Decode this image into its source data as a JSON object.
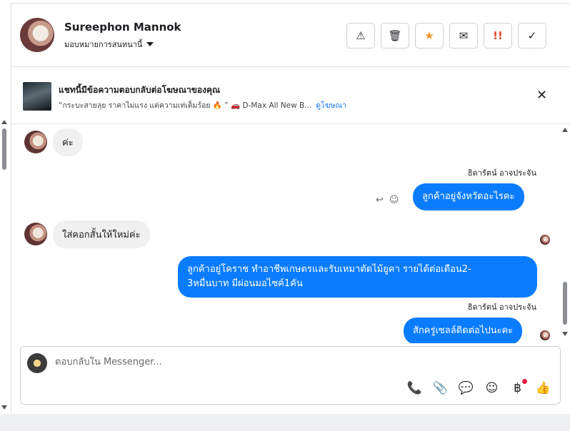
{
  "header": {
    "contact_name": "Sureephon Mannok",
    "assign_label": "มอบหมายการสนทนานี้",
    "actions": [
      {
        "name": "report-button",
        "icon": "⚠"
      },
      {
        "name": "delete-button",
        "icon": "🗑"
      },
      {
        "name": "star-button",
        "icon": "★"
      },
      {
        "name": "mark-unread-button",
        "icon": "✉"
      },
      {
        "name": "mark-urgent-button",
        "icon": "!!"
      },
      {
        "name": "mark-done-button",
        "icon": "✓"
      }
    ]
  },
  "ad": {
    "title": "แชทนี้มีข้อความตอบกลับต่อโฆษณาของคุณ",
    "subtitle": "“กระบะสายลุย ราคาไม่แรง แต่ความเท่เต็มร้อย 🔥 ” 🚗 D-Max All New B...",
    "link": "ดูโฆษณา",
    "close_icon": "✕"
  },
  "messages": [
    {
      "dir": "in",
      "text": "ค่ะ"
    },
    {
      "dir": "out",
      "sender": "ธิดารัตน์ อาจประจัน",
      "text": "ลูกค้าอยู่จังหวัดอะไรคะ"
    },
    {
      "dir": "in",
      "text": "ใส่คอกสั้นให้ใหม่ค่ะ"
    },
    {
      "dir": "out",
      "text_line1": "ลูกค้าอยู่โคราช ทำอาชีพเกษตรและรับเหมาตัดไม้ยูคา รายได้ต่อเดือน2-",
      "text_line2": "3หมื่นบาท มีผ่อนมอไซค์1คัน"
    },
    {
      "dir": "out",
      "sender": "ธิดารัตน์ อาจประจัน",
      "text": "สักครู่เซลล์ติดต่อไปนะคะ"
    }
  ],
  "composer": {
    "placeholder": "ตอบกลับใน Messenger...",
    "tools": [
      "📞",
      "📎",
      "💬",
      "☺",
      "฿",
      "👍"
    ]
  },
  "colors": {
    "bubble_out": "#0a7cff",
    "bubble_in": "#f0f0f0",
    "link": "#1877f2",
    "star": "#f0932b",
    "urgent": "#e4412e"
  }
}
